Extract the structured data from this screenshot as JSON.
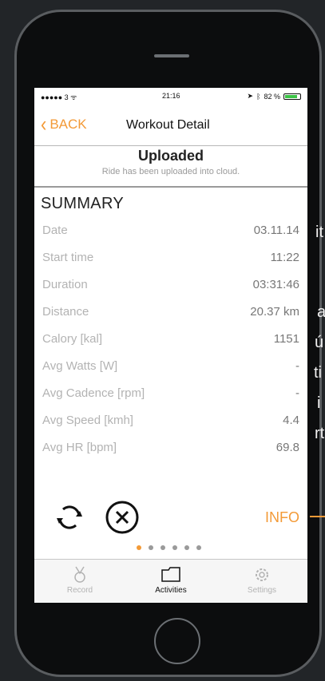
{
  "status_bar": {
    "carrier": "●●●●● 3 ᯤ",
    "time": "21:16",
    "battery_text": "82 %",
    "battery_level": 0.82
  },
  "nav": {
    "back_label": "BACK",
    "title": "Workout Detail"
  },
  "upload": {
    "title": "Uploaded",
    "subtitle": "Ride has been uploaded into cloud."
  },
  "summary": {
    "title": "SUMMARY",
    "rows": [
      {
        "label": "Date",
        "value": "03.11.14"
      },
      {
        "label": "Start time",
        "value": "11:22"
      },
      {
        "label": "Duration",
        "value": "03:31:46"
      },
      {
        "label": "Distance",
        "value": "20.37 km"
      },
      {
        "label": "Calory [kal]",
        "value": "1151"
      },
      {
        "label": "Avg Watts [W]",
        "value": "-"
      },
      {
        "label": "Avg Cadence [rpm]",
        "value": "-"
      },
      {
        "label": "Avg Speed [kmh]",
        "value": "4.4"
      },
      {
        "label": "Avg HR [bpm]",
        "value": "69.8"
      }
    ]
  },
  "actions": {
    "info_label": "INFO"
  },
  "pager": {
    "count": 6,
    "active_index": 0
  },
  "tabbar": {
    "tabs": [
      {
        "label": "Record",
        "icon": "medal-icon"
      },
      {
        "label": "Activities",
        "icon": "folder-icon"
      },
      {
        "label": "Settings",
        "icon": "gear-icon"
      }
    ]
  },
  "overlay_fragments": [
    "it",
    "a",
    "ú",
    "ti",
    "i",
    "rt"
  ],
  "colors": {
    "accent": "#f39a37",
    "screen_bg": "#ffffff",
    "label_gray": "#b3b3b3",
    "value_gray": "#777777",
    "battery_green": "#3cc447"
  }
}
